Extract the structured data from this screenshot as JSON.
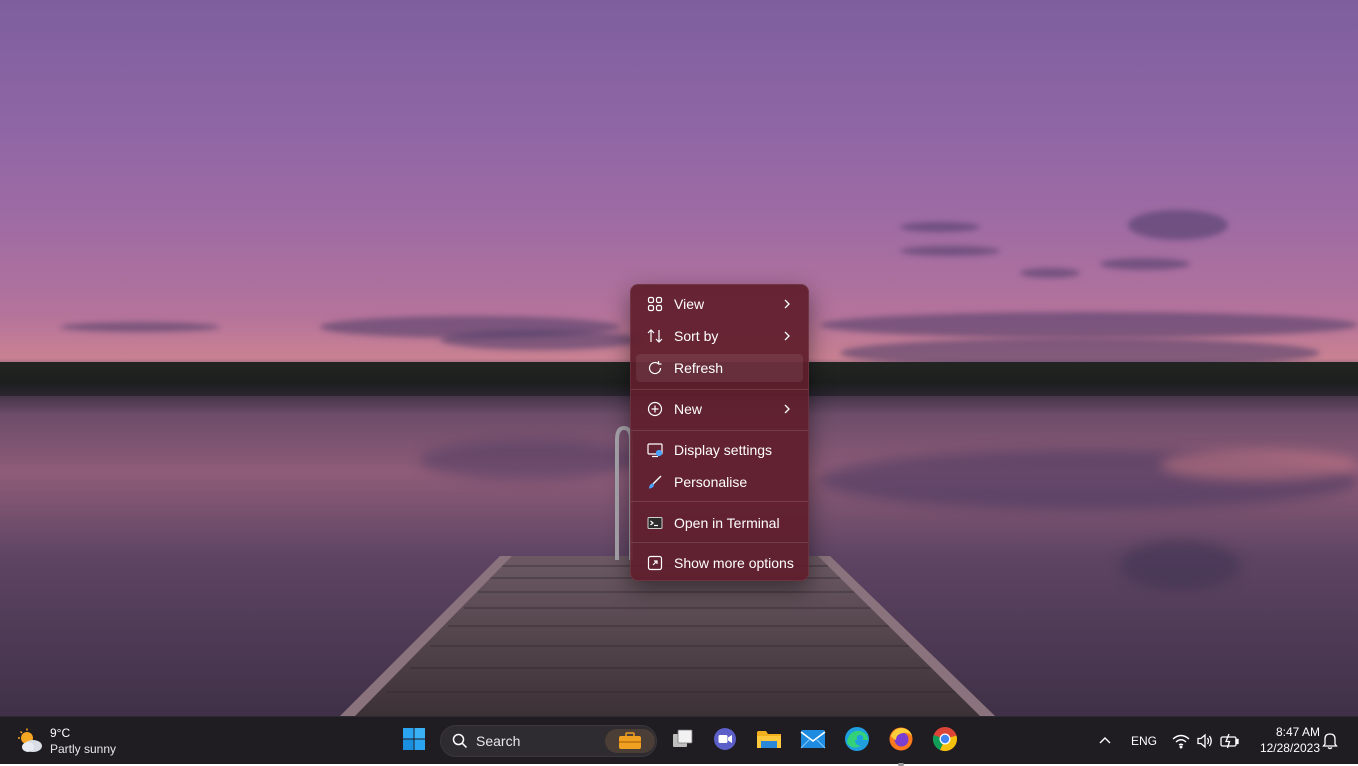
{
  "context_menu": {
    "items": [
      {
        "label": "View",
        "icon": "view-grid-icon",
        "has_submenu": true
      },
      {
        "label": "Sort by",
        "icon": "sort-icon",
        "has_submenu": true
      },
      {
        "label": "Refresh",
        "icon": "refresh-icon",
        "has_submenu": false,
        "highlighted": true
      },
      {
        "label": "New",
        "icon": "new-plus-icon",
        "has_submenu": true
      },
      {
        "label": "Display settings",
        "icon": "display-settings-icon",
        "has_submenu": false
      },
      {
        "label": "Personalise",
        "icon": "brush-icon",
        "has_submenu": false
      },
      {
        "label": "Open in Terminal",
        "icon": "terminal-icon",
        "has_submenu": false
      },
      {
        "label": "Show more options",
        "icon": "more-options-icon",
        "has_submenu": false
      }
    ],
    "background_color": "#601e2c"
  },
  "taskbar": {
    "weather": {
      "temperature": "9°C",
      "description": "Partly sunny",
      "icon": "partly-sunny-icon"
    },
    "search": {
      "placeholder": "Search"
    },
    "apps": [
      {
        "name": "start",
        "icon": "windows-start-icon"
      },
      {
        "name": "task-view",
        "icon": "task-view-icon"
      },
      {
        "name": "teams-meet",
        "icon": "meet-video-icon"
      },
      {
        "name": "file-explorer",
        "icon": "folder-icon"
      },
      {
        "name": "mail",
        "icon": "mail-icon"
      },
      {
        "name": "edge",
        "icon": "edge-icon"
      },
      {
        "name": "firefox",
        "icon": "firefox-icon",
        "running": true
      },
      {
        "name": "chrome",
        "icon": "chrome-icon"
      }
    ],
    "tray": {
      "language": "ENG",
      "time": "8:47 AM",
      "date": "12/28/2023"
    },
    "accent_color": "#0078d4"
  }
}
